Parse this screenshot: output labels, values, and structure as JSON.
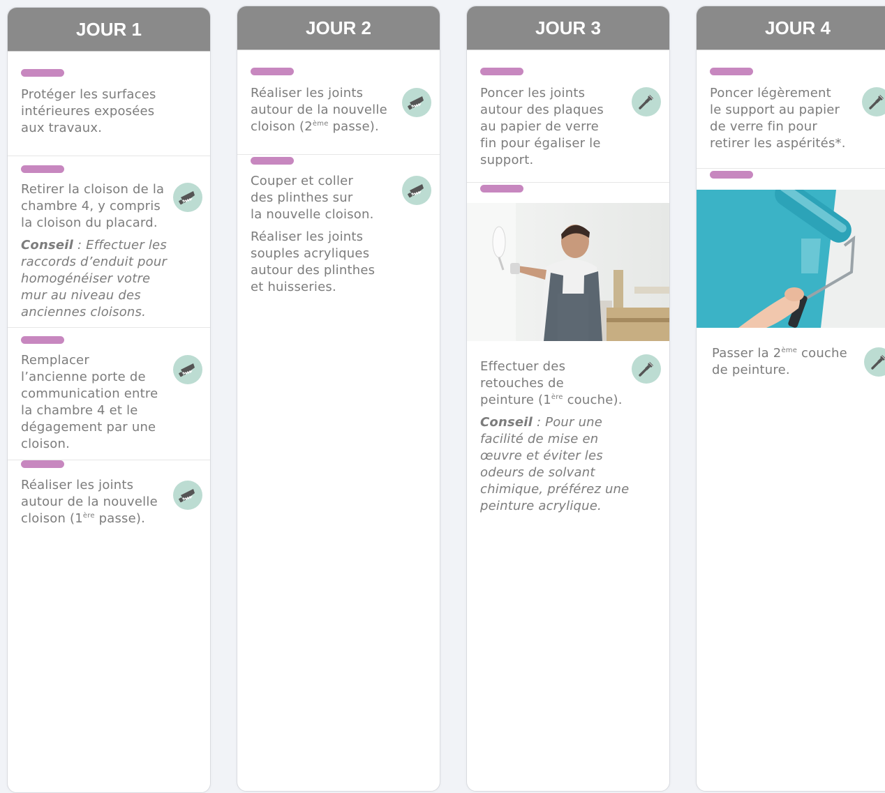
{
  "colors": {
    "header": "#8a8a8a",
    "pill": "#c787bf",
    "icon_bg": "#bcdcd2",
    "icon_fg": "#555555",
    "text": "#7c7c7c",
    "wall": "#3bb3c6"
  },
  "days": [
    {
      "title": "JOUR 1",
      "tasks": [
        {
          "lines": [
            "Protéger les surfaces",
            "intérieures exposées",
            "aux travaux."
          ]
        },
        {
          "icon": "saw-icon",
          "lines": [
            "Retirer la cloison de la",
            "chambre 4, y compris",
            "la cloison du placard."
          ],
          "tip_label": "Conseil",
          "tip_lines": [
            " : Effectuer les",
            "raccords d’enduit pour",
            "homogénéiser votre",
            "mur au niveau des",
            "anciennes cloisons."
          ]
        },
        {
          "icon": "saw-icon",
          "lines": [
            "Remplacer",
            "l’ancienne porte de",
            "communication entre",
            "la chambre 4 et le",
            "dégagement par une",
            "cloison."
          ]
        },
        {
          "icon": "saw-icon",
          "lines": [
            "Réaliser les joints",
            "autour de la nouvelle"
          ],
          "last_pre": "cloison (1",
          "last_sup": "ère",
          "last_post": " passe)."
        }
      ]
    },
    {
      "title": "JOUR 2",
      "tasks": [
        {
          "icon": "saw-icon",
          "lines": [
            "Réaliser les joints",
            "autour de la nouvelle"
          ],
          "last_pre": "cloison (2",
          "last_sup": "ème",
          "last_post": " passe)."
        },
        {
          "icon": "saw-icon",
          "lines": [
            "Couper et coller",
            "des plinthes sur",
            "la nouvelle cloison."
          ],
          "lines2": [
            "Réaliser les joints",
            "souples acryliques",
            "autour des plinthes",
            "et huisseries."
          ]
        }
      ]
    },
    {
      "title": "JOUR 3",
      "tasks": [
        {
          "icon": "paint-brush-icon",
          "lines": [
            "Poncer les joints",
            "autour des plaques",
            "au papier de verre",
            "fin pour égaliser le",
            "support."
          ]
        },
        {
          "icon": "paint-brush-icon",
          "photo": "painter-man-photo",
          "lines": [
            "Effectuer des",
            "retouches de"
          ],
          "last_pre": "peinture (1",
          "last_sup": "ère",
          "last_post": " couche).",
          "tip_label": "Conseil",
          "tip_lines": [
            " : Pour une",
            "facilité de mise en",
            "œuvre et éviter les",
            "odeurs de solvant",
            "chimique, préférez une",
            "peinture acrylique."
          ]
        }
      ]
    },
    {
      "title": "JOUR 4",
      "tasks": [
        {
          "icon": "paint-brush-icon",
          "lines": [
            "Poncer légèrement",
            "le support au papier",
            "de verre fin pour",
            "retirer les aspérités*."
          ]
        },
        {
          "icon": "paint-brush-icon",
          "photo": "paint-roller-photo",
          "first_pre": "Passer la 2",
          "first_sup": "ème",
          "first_post": " couche",
          "lines": [
            "de peinture."
          ]
        }
      ]
    }
  ]
}
